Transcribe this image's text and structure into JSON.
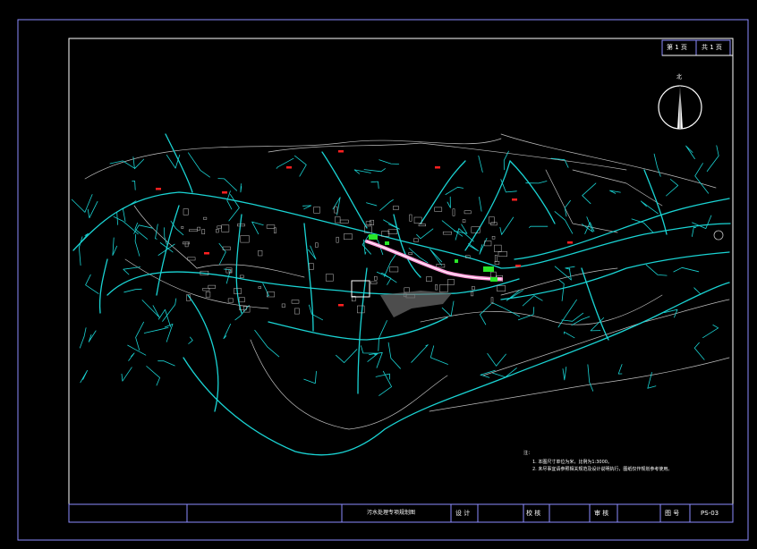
{
  "sheet": {
    "page_label_left": "第 1 页",
    "page_label_right": "共 1 页",
    "north_label": "北",
    "title": "污水处理专项规划图",
    "designer_label": "设 计",
    "checker_label": "校 核",
    "reviewer_label": "审 核",
    "drawing_no_label": "图 号",
    "drawing_no": "PS-03"
  },
  "notes": {
    "header": "注：",
    "items": [
      "1. 本图尺寸单位为米，比例为1:3000。",
      "2. 未尽事宜请参照相关规范及设计说明执行，图纸仅作规划参考使用。"
    ]
  },
  "colors": {
    "frame": "#8c8cff",
    "pipes": "#1ad4d4",
    "roads": "#bfbfbf",
    "labels": "#ff2020",
    "facility": "#29e629",
    "highlight": "#ff9ad9"
  }
}
